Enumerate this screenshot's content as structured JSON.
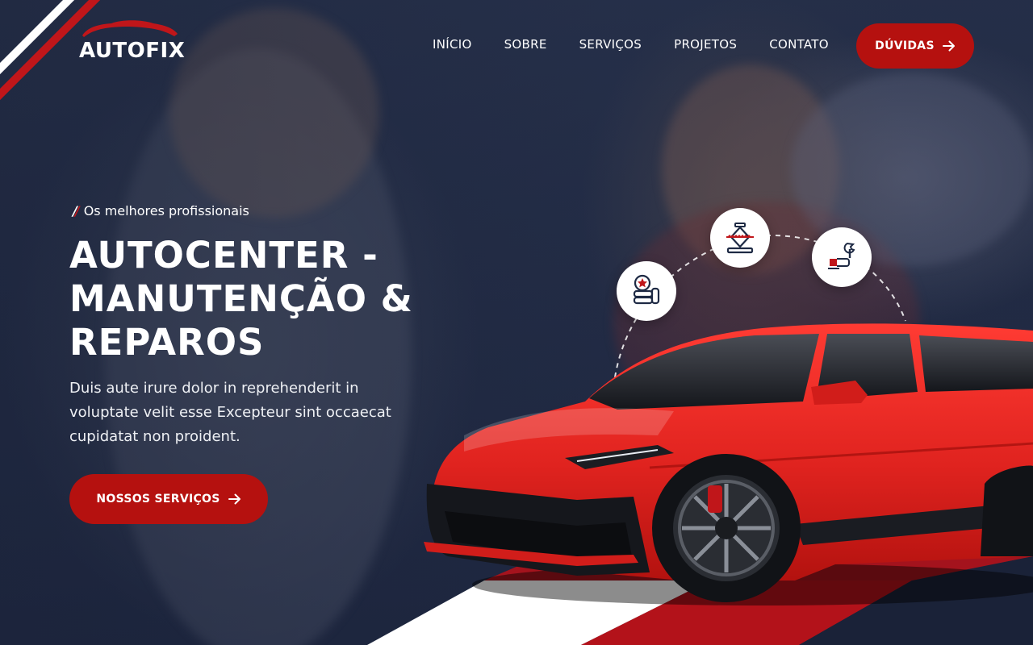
{
  "brand": {
    "name": "AUTOFIX"
  },
  "nav": {
    "items": [
      {
        "label": "INÍCIO"
      },
      {
        "label": "SOBRE"
      },
      {
        "label": "SERVIÇOS"
      },
      {
        "label": "PROJETOS"
      },
      {
        "label": "CONTATO"
      }
    ],
    "cta_label": "DÚVIDAS"
  },
  "hero": {
    "tagline": "Os melhores profissionais",
    "title_lines": [
      "AUTOCENTER -",
      "MANUTENÇÃO &",
      "REPAROS"
    ],
    "description": "Duis aute irure dolor in reprehenderit in voluptate velit esse Excepteur sint occaecat cupidatat non proident.",
    "cta_label": "NOSSOS SERVIÇOS"
  },
  "service_icons": [
    "tire-service-icon",
    "car-jack-icon",
    "wrench-hand-icon"
  ],
  "colors": {
    "accent": "#b5110f",
    "background": "#1f2740",
    "text": "#ffffff",
    "car": "#e0231f"
  }
}
